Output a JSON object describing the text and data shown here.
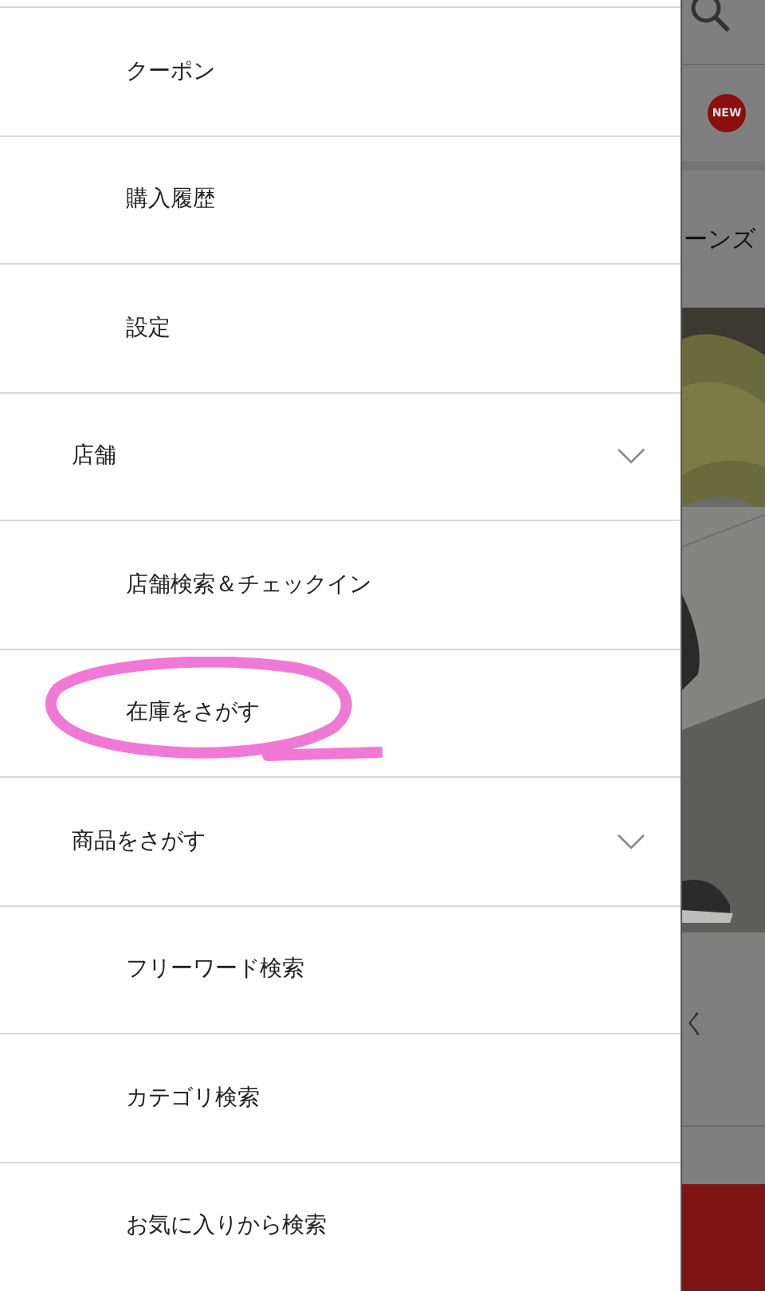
{
  "menu": {
    "items": [
      {
        "label": "クーポン",
        "kind": "child"
      },
      {
        "label": "購入履歴",
        "kind": "child"
      },
      {
        "label": "設定",
        "kind": "child"
      },
      {
        "label": "店舗",
        "kind": "section",
        "expanded": true
      },
      {
        "label": "店舗検索＆チェックイン",
        "kind": "child"
      },
      {
        "label": "在庫をさがす",
        "kind": "child",
        "annotated": true
      },
      {
        "label": "商品をさがす",
        "kind": "section",
        "expanded": true
      },
      {
        "label": "フリーワード検索",
        "kind": "child"
      },
      {
        "label": "カテゴリ検索",
        "kind": "child"
      },
      {
        "label": "お気に入りから検索",
        "kind": "child"
      }
    ]
  },
  "background_page": {
    "badge": "NEW",
    "heading": "ーンズ",
    "caption": "く"
  }
}
